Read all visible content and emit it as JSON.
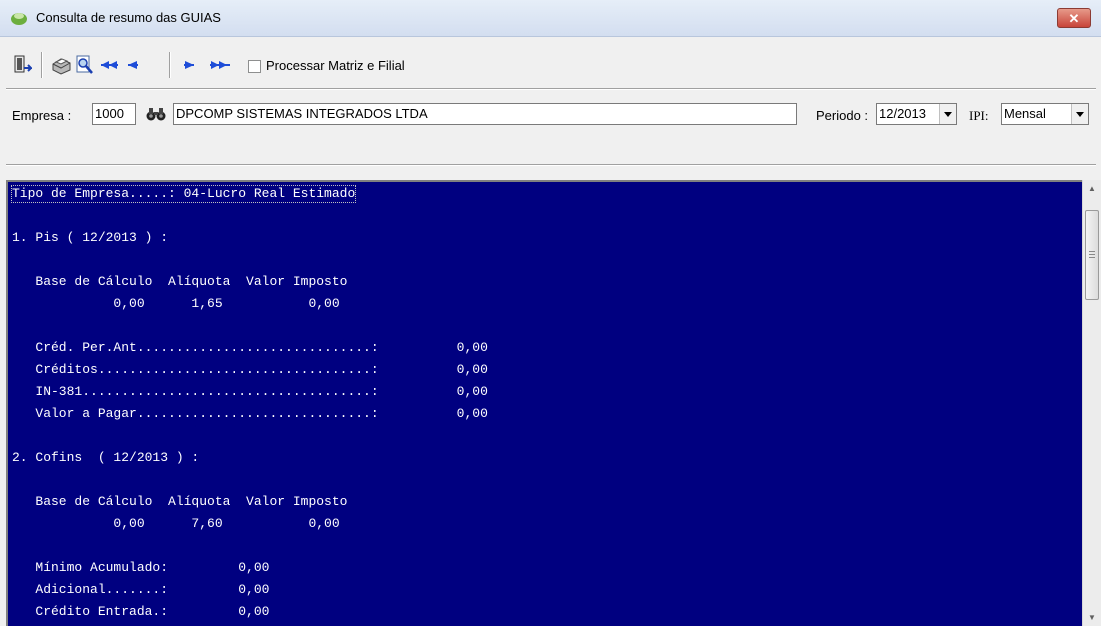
{
  "window": {
    "title": "Consulta de resumo das GUIAS",
    "close_label": "✕"
  },
  "toolbar": {
    "icons": [
      "exit-icon",
      "printer-icon",
      "preview-icon",
      "first-record-icon",
      "previous-record-icon",
      "next-record-icon",
      "last-record-icon"
    ],
    "checkbox_label": "Processar Matriz e Filial",
    "checkbox_checked": false
  },
  "filters": {
    "empresa_label": "Empresa :",
    "empresa_code": "1000",
    "empresa_name": "DPCOMP SISTEMAS INTEGRADOS LTDA",
    "periodo_label": "Periodo :",
    "periodo_value": "12/2013",
    "ipi_label": "IPI:",
    "ipi_value": "Mensal"
  },
  "report": {
    "lines": [
      "Tipo de Empresa.....: 04-Lucro Real Estimado",
      "",
      "1. Pis ( 12/2013 ) :",
      "",
      "   Base de Cálculo  Alíquota  Valor Imposto",
      "             0,00      1,65           0,00",
      "",
      "   Créd. Per.Ant..............................:          0,00",
      "   Créditos...................................:          0,00",
      "   IN-381.....................................:          0,00",
      "   Valor a Pagar..............................:          0,00",
      "",
      "2. Cofins  ( 12/2013 ) :",
      "",
      "   Base de Cálculo  Alíquota  Valor Imposto",
      "             0,00      7,60           0,00",
      "",
      "   Mínimo Acumulado:         0,00",
      "   Adicional.......:         0,00",
      "   Crédito Entrada.:         0,00"
    ]
  }
}
